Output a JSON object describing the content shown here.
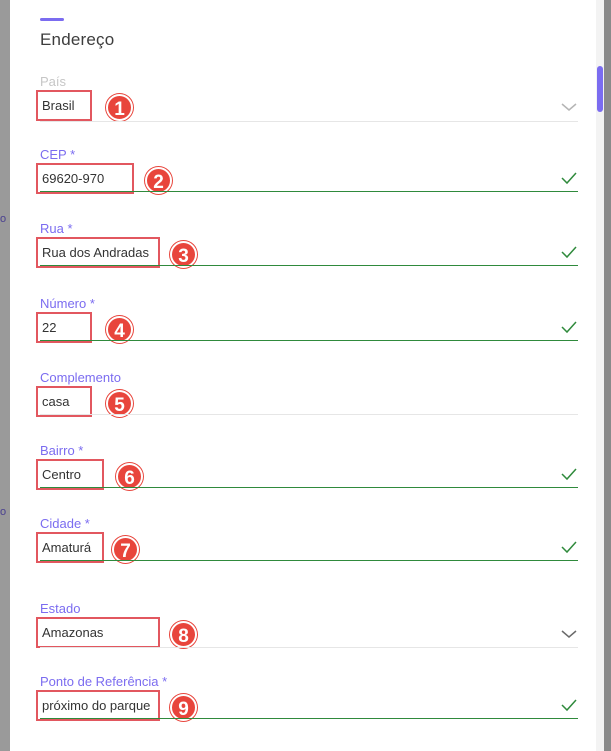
{
  "section": {
    "title": "Endereço"
  },
  "backdrop": {
    "glyph_a": "o",
    "glyph_b": "o"
  },
  "fields": [
    {
      "label": "País",
      "value": "Brasil",
      "badge": "1",
      "control": "dropdown",
      "valid": false
    },
    {
      "label": "CEP *",
      "value": "69620-970",
      "badge": "2",
      "control": "text",
      "valid": true
    },
    {
      "label": "Rua *",
      "value": "Rua dos Andradas",
      "badge": "3",
      "control": "text",
      "valid": true
    },
    {
      "label": "Número *",
      "value": "22",
      "badge": "4",
      "control": "text",
      "valid": true
    },
    {
      "label": "Complemento",
      "value": "casa",
      "badge": "5",
      "control": "text",
      "valid": false
    },
    {
      "label": "Bairro *",
      "value": "Centro",
      "badge": "6",
      "control": "text",
      "valid": true
    },
    {
      "label": "Cidade *",
      "value": "Amaturá",
      "badge": "7",
      "control": "text",
      "valid": true
    },
    {
      "label": "Estado",
      "value": "Amazonas",
      "badge": "8",
      "control": "dropdown",
      "valid": false
    },
    {
      "label": "Ponto de Referência *",
      "value": "próximo do parque",
      "badge": "9",
      "control": "text",
      "valid": true
    }
  ],
  "colors": {
    "accent": "#7b6cf0",
    "valid_line": "#2f8a3c",
    "highlight": "#e2575f"
  }
}
